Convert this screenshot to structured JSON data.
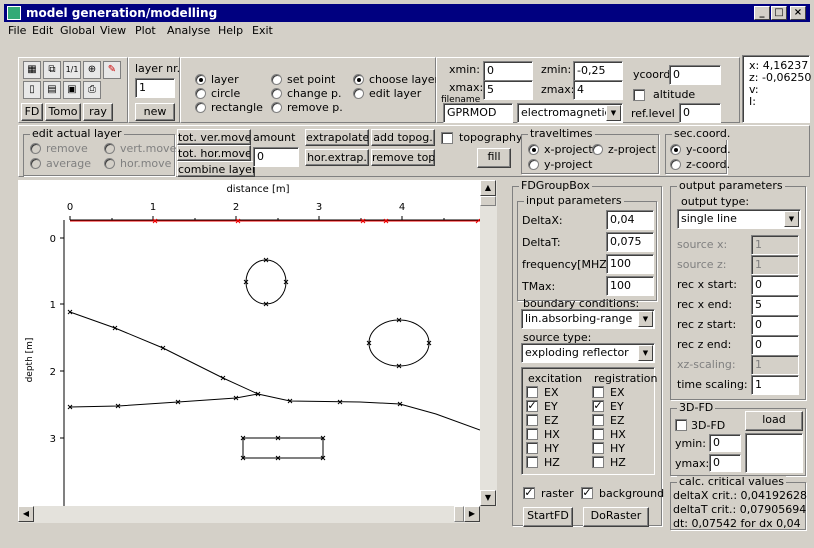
{
  "window": {
    "title": "model generation/modelling",
    "min": "_",
    "max": "□",
    "close": "×"
  },
  "menu": [
    "File",
    "Edit",
    "Global",
    "View",
    "Plot",
    "Analyse",
    "Help",
    "Exit"
  ],
  "toolbar": {
    "layer_nr_label": "layer nr.",
    "layer_nr_value": "1",
    "new_button": "new",
    "tabs": [
      "FD",
      "Tomo",
      "ray"
    ],
    "mode_radios": [
      "layer",
      "circle",
      "rectangle",
      "set point",
      "change p.",
      "remove p.",
      "choose layer",
      "edit layer"
    ],
    "xmin_label": "xmin:",
    "xmin": "0",
    "xmax_label": "xmax:",
    "xmax": "5",
    "zmin_label": "zmin:",
    "zmin": "-0,25",
    "zmax_label": "zmax:",
    "zmax": "4",
    "filename_label": "filename",
    "filename": "GPRMOD",
    "wave_type": "electromagnetic",
    "ycoord_label": "ycoord",
    "ycoord": "0",
    "altitude_label": "altitude",
    "reflevel_label": "ref.level",
    "reflevel": "0",
    "coords": [
      "x: 4,16237",
      "z: -0,06250",
      "v:",
      "I:"
    ]
  },
  "row2": {
    "edit_group_title": "edit actual layer",
    "edit_radios": [
      "remove",
      "vert.move",
      "average",
      "hor.move"
    ],
    "tot_ver_move": "tot. ver.move",
    "tot_hor_move": "tot. hor.move",
    "combine_layers": "combine layers",
    "amount_label": "amount",
    "amount": "0",
    "extrapolate": "extrapolate",
    "add_topog": "add topog.",
    "hor_extrap": "hor.extrap.",
    "remove_top": "remove top.",
    "topography_label": "topography",
    "fill": "fill",
    "traveltimes_title": "traveltimes",
    "tt_radios": [
      "x-project",
      "z-project",
      "y-project"
    ],
    "seccoord_title": "sec.coord.",
    "sc_radios": [
      "y-coord.",
      "z-coord."
    ]
  },
  "plot": {
    "xlabel": "distance [m]",
    "ylabel": "depth [m]",
    "xticks": [
      "0",
      "1",
      "2",
      "3",
      "4"
    ],
    "yticks": [
      "0",
      "1",
      "2",
      "3"
    ]
  },
  "fd": {
    "group_title": "FDGroupBox",
    "input_title": "input parameters",
    "params": [
      {
        "label": "DeltaX:",
        "value": "0,04"
      },
      {
        "label": "DeltaT:",
        "value": "0,075"
      },
      {
        "label": "frequency[MHZ]",
        "value": "100"
      },
      {
        "label": "TMax:",
        "value": "100"
      }
    ],
    "boundary_label": "boundary conditions:",
    "boundary_value": "lin.absorbing-range",
    "source_label": "source type:",
    "source_value": "exploding reflector",
    "excitation_label": "excitation",
    "registration_label": "registration",
    "fields": [
      "EX",
      "EY",
      "EZ",
      "HX",
      "HY",
      "HZ"
    ],
    "excitation_checked": [
      "EY"
    ],
    "registration_checked": [
      "EY"
    ],
    "raster_label": "raster",
    "background_label": "background",
    "startfd": "StartFD",
    "doraster": "DoRaster"
  },
  "output": {
    "title": "output parameters",
    "type_label": "output type:",
    "type_value": "single line",
    "params": [
      {
        "label": "source x:",
        "value": "1",
        "enabled": false
      },
      {
        "label": "source z:",
        "value": "1",
        "enabled": false
      },
      {
        "label": "rec x start:",
        "value": "0",
        "enabled": true
      },
      {
        "label": "rec x end:",
        "value": "5",
        "enabled": true
      },
      {
        "label": "rec z start:",
        "value": "0",
        "enabled": true
      },
      {
        "label": "rec z end:",
        "value": "0",
        "enabled": true
      },
      {
        "label": "xz-scaling:",
        "value": "1",
        "enabled": false
      },
      {
        "label": "time scaling:",
        "value": "1",
        "enabled": true
      }
    ]
  },
  "fd3d": {
    "title": "3D-FD",
    "check_label": "3D-FD",
    "load": "load",
    "ymin_label": "ymin:",
    "ymin": "0",
    "ymax_label": "ymax:",
    "ymax": "0"
  },
  "critical": {
    "title": "calc. critical values",
    "lines": [
      "deltaX crit.: 0,04192628",
      "deltaT crit.: 0,07905694",
      "dt: 0,07542 for dx 0,04"
    ]
  }
}
